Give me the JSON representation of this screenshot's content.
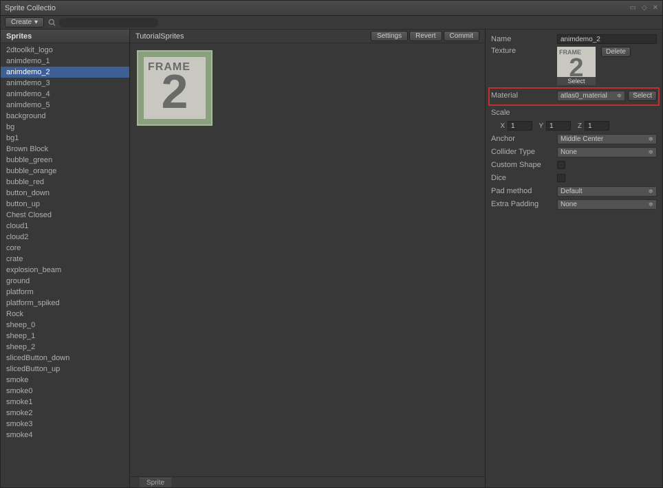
{
  "window": {
    "title": "Sprite Collectio"
  },
  "toolbar": {
    "create_label": "Create"
  },
  "sidebar": {
    "header": "Sprites",
    "items": [
      "2dtoolkit_logo",
      "animdemo_1",
      "animdemo_2",
      "animdemo_3",
      "animdemo_4",
      "animdemo_5",
      "background",
      "bg",
      "bg1",
      "Brown Block",
      "bubble_green",
      "bubble_orange",
      "bubble_red",
      "button_down",
      "button_up",
      "Chest Closed",
      "cloud1",
      "cloud2",
      "core",
      "crate",
      "explosion_beam",
      "ground",
      "platform",
      "platform_spiked",
      "Rock",
      "sheep_0",
      "sheep_1",
      "sheep_2",
      "slicedButton_down",
      "slicedButton_up",
      "smoke",
      "smoke0",
      "smoke1",
      "smoke2",
      "smoke3",
      "smoke4"
    ],
    "selected_index": 2
  },
  "center": {
    "title": "TutorialSprites",
    "buttons": {
      "settings": "Settings",
      "revert": "Revert",
      "commit": "Commit"
    },
    "bottom_tab": "Sprite",
    "thumb": {
      "frame_label": "FRAME",
      "number": "2"
    }
  },
  "properties": {
    "name": {
      "label": "Name",
      "value": "animdemo_2"
    },
    "texture": {
      "label": "Texture",
      "select": "Select",
      "delete": "Delete"
    },
    "material": {
      "label": "Material",
      "value": "atlas0_material",
      "select": "Select"
    },
    "scale": {
      "label": "Scale",
      "x": "1",
      "y": "1",
      "z": "1"
    },
    "anchor": {
      "label": "Anchor",
      "value": "Middle Center"
    },
    "collider_type": {
      "label": "Collider Type",
      "value": "None"
    },
    "custom_shape": {
      "label": "Custom Shape"
    },
    "dice": {
      "label": "Dice"
    },
    "pad_method": {
      "label": "Pad method",
      "value": "Default"
    },
    "extra_padding": {
      "label": "Extra Padding",
      "value": "None"
    }
  }
}
